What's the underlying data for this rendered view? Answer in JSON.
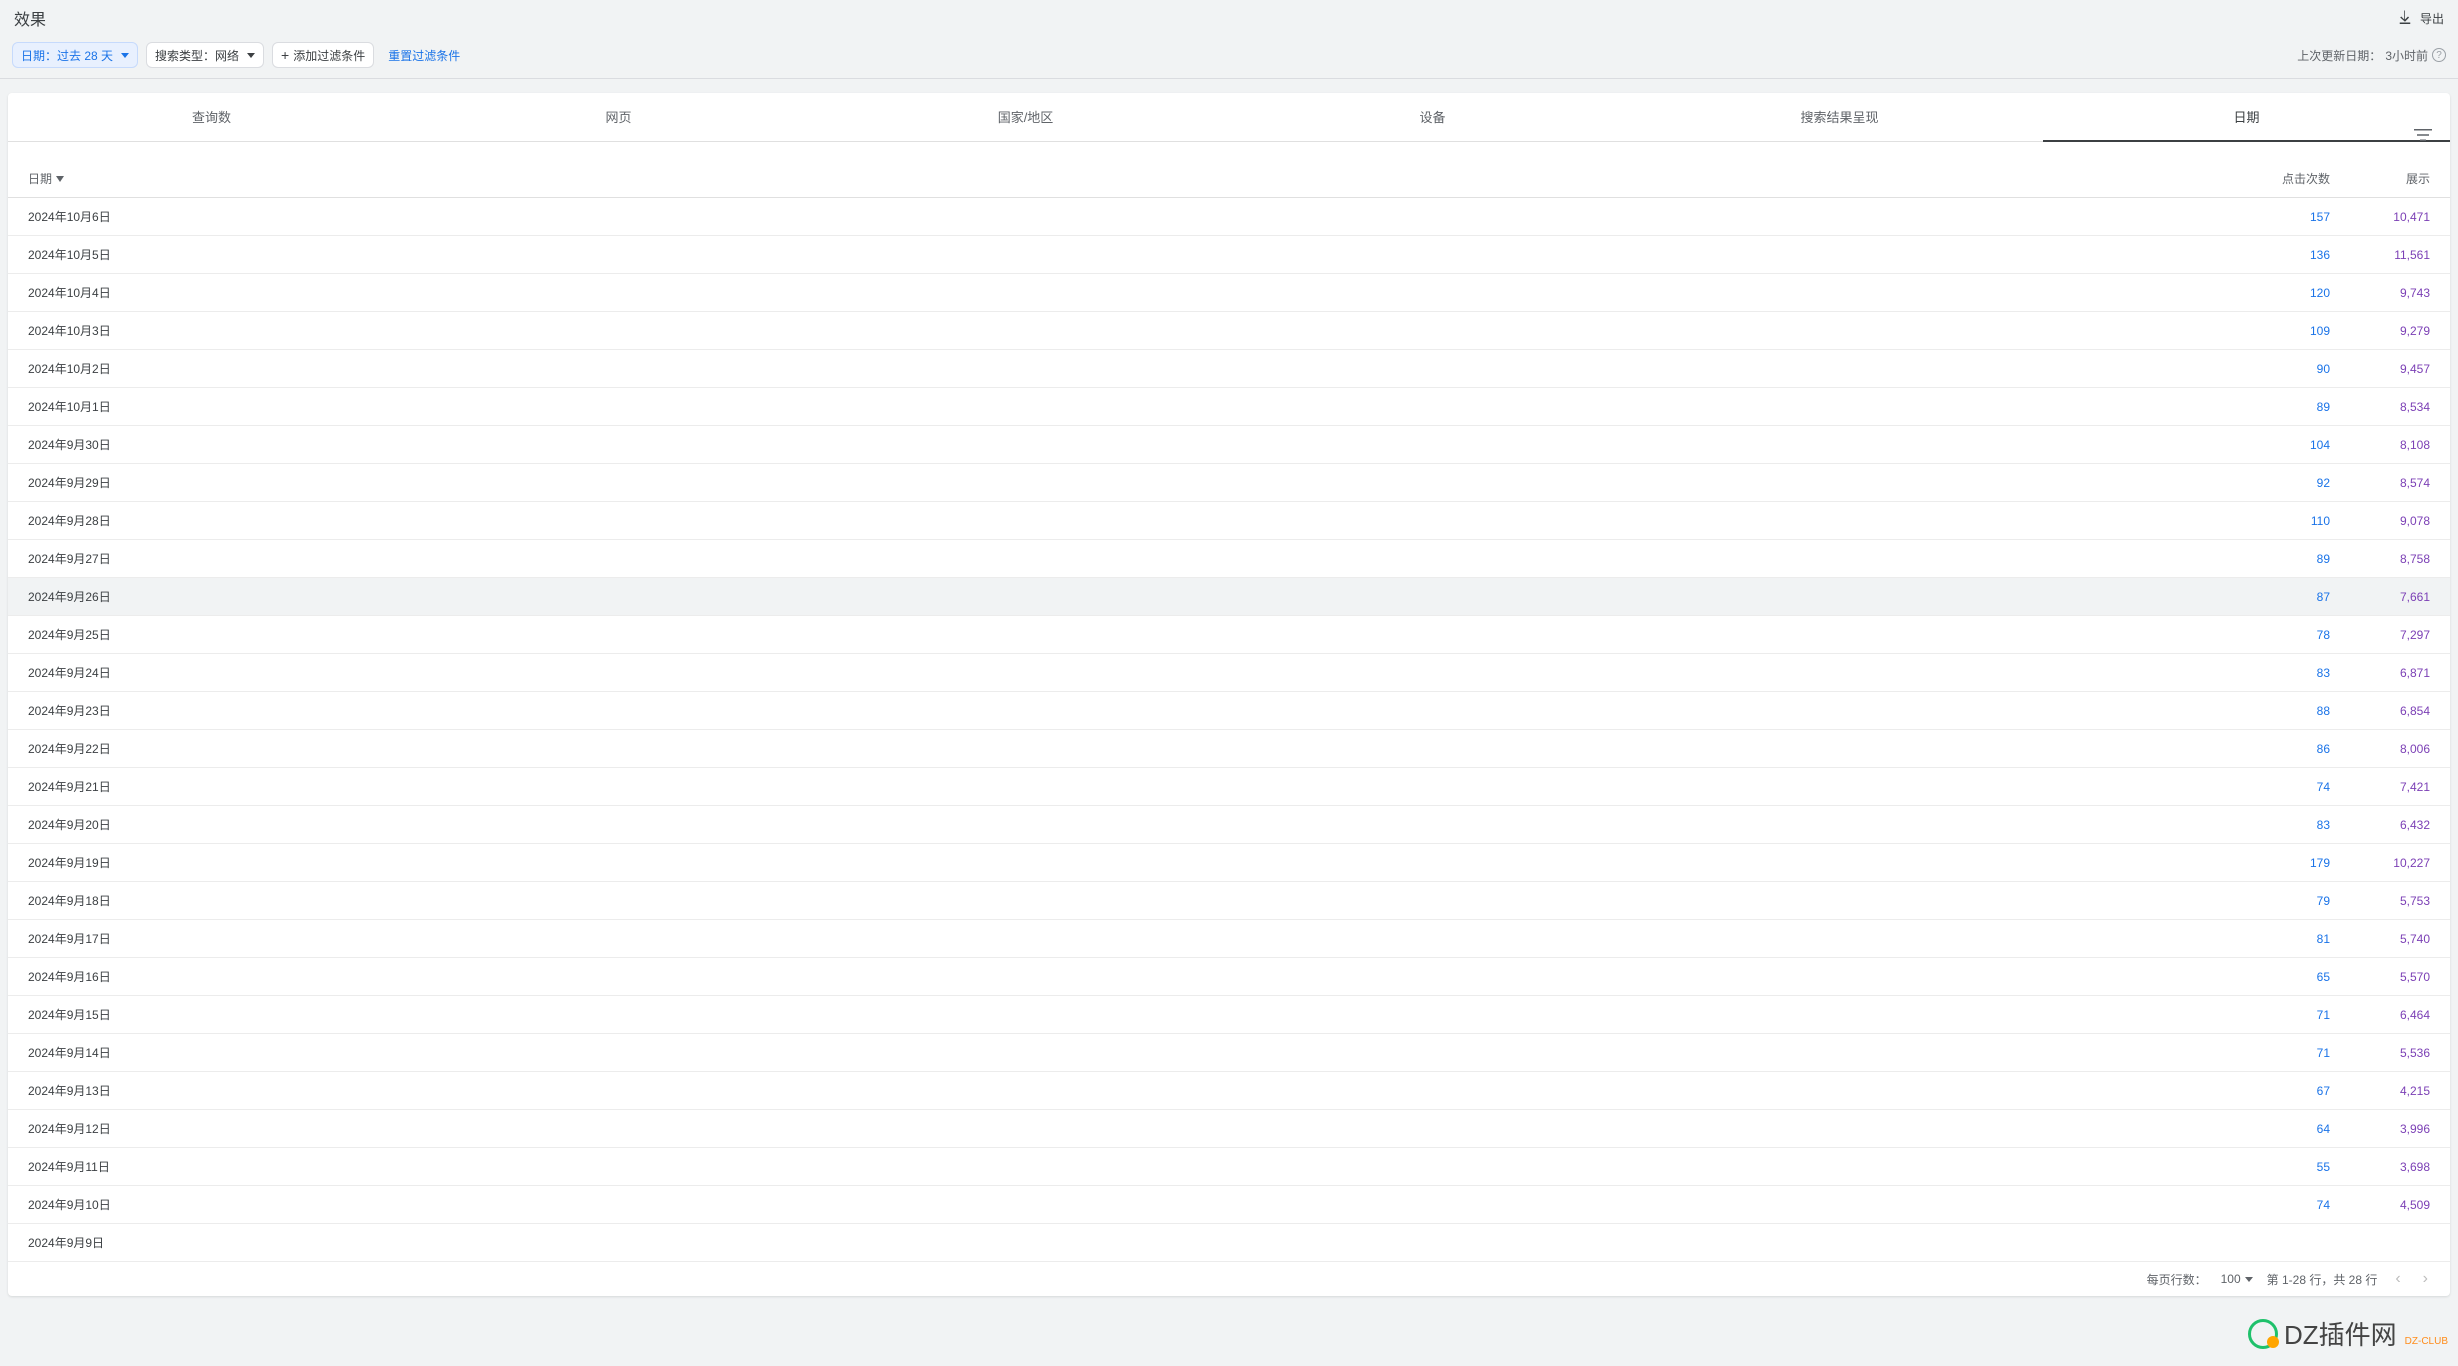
{
  "header": {
    "title": "效果",
    "export_label": "导出"
  },
  "filters": {
    "date_chip": "日期：过去 28 天",
    "type_chip": "搜索类型：网络",
    "add_chip": "添加过滤条件",
    "reset": "重置过滤条件",
    "last_updated_label": "上次更新日期：",
    "last_updated_value": "3小时前"
  },
  "tabs": [
    {
      "label": "查询数"
    },
    {
      "label": "网页"
    },
    {
      "label": "国家/地区"
    },
    {
      "label": "设备"
    },
    {
      "label": "搜索结果呈现"
    },
    {
      "label": "日期"
    }
  ],
  "active_tab_index": 5,
  "columns": {
    "date": "日期",
    "clicks": "点击次数",
    "impressions": "展示"
  },
  "highlighted_row_index": 10,
  "rows": [
    {
      "date": "2024年10月6日",
      "clicks": "157",
      "impressions": "10,471"
    },
    {
      "date": "2024年10月5日",
      "clicks": "136",
      "impressions": "11,561"
    },
    {
      "date": "2024年10月4日",
      "clicks": "120",
      "impressions": "9,743"
    },
    {
      "date": "2024年10月3日",
      "clicks": "109",
      "impressions": "9,279"
    },
    {
      "date": "2024年10月2日",
      "clicks": "90",
      "impressions": "9,457"
    },
    {
      "date": "2024年10月1日",
      "clicks": "89",
      "impressions": "8,534"
    },
    {
      "date": "2024年9月30日",
      "clicks": "104",
      "impressions": "8,108"
    },
    {
      "date": "2024年9月29日",
      "clicks": "92",
      "impressions": "8,574"
    },
    {
      "date": "2024年9月28日",
      "clicks": "110",
      "impressions": "9,078"
    },
    {
      "date": "2024年9月27日",
      "clicks": "89",
      "impressions": "8,758"
    },
    {
      "date": "2024年9月26日",
      "clicks": "87",
      "impressions": "7,661"
    },
    {
      "date": "2024年9月25日",
      "clicks": "78",
      "impressions": "7,297"
    },
    {
      "date": "2024年9月24日",
      "clicks": "83",
      "impressions": "6,871"
    },
    {
      "date": "2024年9月23日",
      "clicks": "88",
      "impressions": "6,854"
    },
    {
      "date": "2024年9月22日",
      "clicks": "86",
      "impressions": "8,006"
    },
    {
      "date": "2024年9月21日",
      "clicks": "74",
      "impressions": "7,421"
    },
    {
      "date": "2024年9月20日",
      "clicks": "83",
      "impressions": "6,432"
    },
    {
      "date": "2024年9月19日",
      "clicks": "179",
      "impressions": "10,227"
    },
    {
      "date": "2024年9月18日",
      "clicks": "79",
      "impressions": "5,753"
    },
    {
      "date": "2024年9月17日",
      "clicks": "81",
      "impressions": "5,740"
    },
    {
      "date": "2024年9月16日",
      "clicks": "65",
      "impressions": "5,570"
    },
    {
      "date": "2024年9月15日",
      "clicks": "71",
      "impressions": "6,464"
    },
    {
      "date": "2024年9月14日",
      "clicks": "71",
      "impressions": "5,536"
    },
    {
      "date": "2024年9月13日",
      "clicks": "67",
      "impressions": "4,215"
    },
    {
      "date": "2024年9月12日",
      "clicks": "64",
      "impressions": "3,996"
    },
    {
      "date": "2024年9月11日",
      "clicks": "55",
      "impressions": "3,698"
    },
    {
      "date": "2024年9月10日",
      "clicks": "74",
      "impressions": "4,509"
    },
    {
      "date": "2024年9月9日",
      "clicks": "",
      "impressions": ""
    }
  ],
  "pagination": {
    "rows_per_page_label": "每页行数：",
    "rows_per_page_value": "100",
    "range_text": "第 1-28 行，共 28 行"
  },
  "watermark": {
    "text": "DZ插件网",
    "sub": "DZ-CLUB"
  }
}
